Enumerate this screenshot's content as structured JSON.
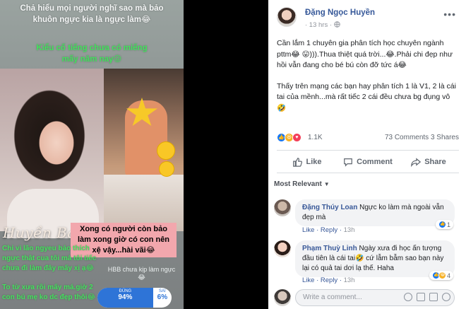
{
  "story": {
    "line1": "Chả hiểu mọi người nghĩ sao mà bảo khuôn ngực kia là ngực làm😂",
    "line2": "Kiểu cố tiếng chưa có miếng mấy năm nay😜",
    "name_tag": "Huyền Baby -",
    "green_bottom": "Chỉ vì lão ngyeu bảo thích ngực thật cua tôi mà tôi tiếc chưa đi làm đây mấy xị ạ😂",
    "green_bottom2": "To từ xưa rồi mấy má.giờ 2 con bú mẹ ko dc đẹp thôi😂",
    "pink_box": "Xong có người còn bảo làm xong giờ có con nên xệ vậy...hài vãi😂",
    "small_caption": "HBB chưa kịp làm ngực😂",
    "poll": {
      "left_label": "ĐÚNG",
      "left_value": "94%",
      "right_label": "SAI",
      "right_value": "6%",
      "left_share": 0.94
    }
  },
  "post": {
    "author": "Đặng Ngọc Huyền",
    "time": "· 13 hrs ·",
    "globe_icon": "globe-icon",
    "paragraph1": "Cần lắm 1 chuyên gia phân tích học chuyên ngành pttm😂 😛))).Thua thiệt quá trời...😂.Phải chi đẹp như hồi vẫn đang cho bé bú còn đỡ tức á😂",
    "paragraph2": "Thấy trên mạng các bạn hay phân tích 1 là V1, 2 là cái tai của mềnh...mà rất tiếc 2 cái đều chưa bg đụng vô🤣",
    "reaction_count": "1.1K",
    "comment_share_count": "73 Comments  3 Shares",
    "actions": {
      "like": "Like",
      "comment": "Comment",
      "share": "Share"
    },
    "sort_label": "Most Relevant",
    "comments": [
      {
        "name": "Đặng Thúy Loan",
        "text": " Ngực ko làm mà ngoài vẫn đẹp mà",
        "like": "Like",
        "reply": "Reply",
        "time": "13h",
        "reaction_count": "1"
      },
      {
        "name": "Phạm Thuỳ Linh",
        "text": " Ngày xưa đi học ấn tượng đầu tiên là cái tai🤣 cứ lẫm bẫm sao bạn này lại có quả tai dơi lạ thế. Haha",
        "like": "Like",
        "reply": "Reply",
        "time": "13h",
        "reaction_count": "4"
      }
    ],
    "write_placeholder": "Write a comment..."
  },
  "colors": {
    "fb_blue": "#365899",
    "link_blue": "#385898",
    "story_green": "#44e25e",
    "pink_box": "#f2a7ad",
    "poll_blue": "#2e74d7"
  }
}
